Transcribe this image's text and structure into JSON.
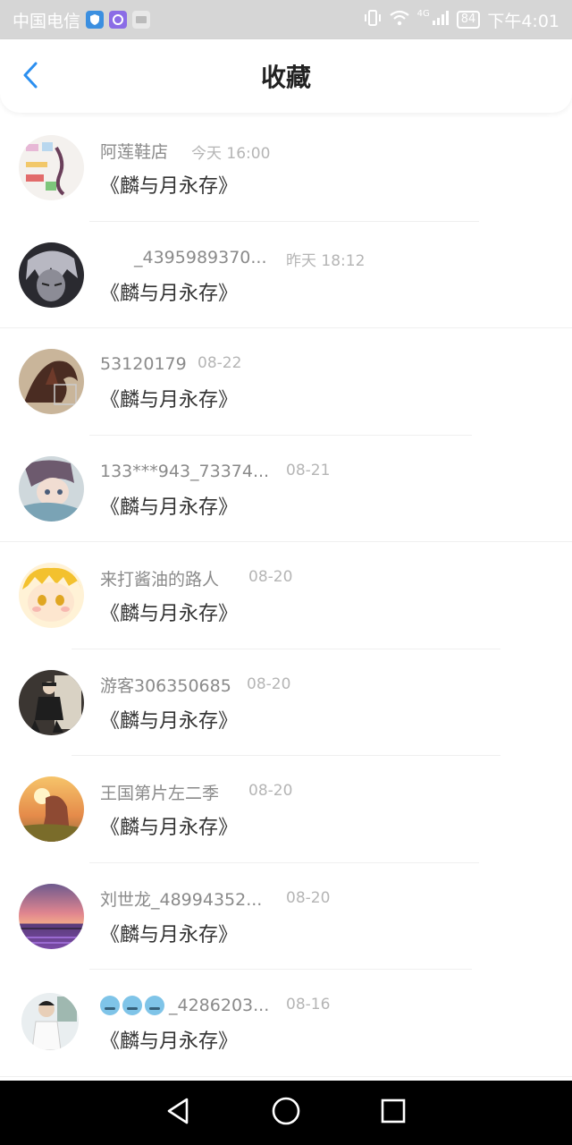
{
  "status_bar": {
    "carrier": "中国电信",
    "network": "4G",
    "battery": "84",
    "time": "下午4:01",
    "icons": [
      "shield-app-icon",
      "purple-app-icon",
      "message-app-icon",
      "vibrate-icon",
      "wifi-icon",
      "signal-icon",
      "battery-icon"
    ]
  },
  "header": {
    "back_icon": "chevron-left-icon",
    "title": "收藏"
  },
  "items": [
    {
      "username": "阿莲鞋店",
      "date": "今天 16:00",
      "content": "《麟与月永存》"
    },
    {
      "username": "_4395989370...",
      "date": "昨天 18:12",
      "content": "《麟与月永存》"
    },
    {
      "username": "53120179",
      "date": "08-22",
      "content": "《麟与月永存》"
    },
    {
      "username": "133***943_73374...",
      "date": "08-21",
      "content": "《麟与月永存》"
    },
    {
      "username": "来打酱油的路人",
      "date": "08-20",
      "content": "《麟与月永存》"
    },
    {
      "username": "游客306350685",
      "date": "08-20",
      "content": "《麟与月永存》"
    },
    {
      "username": "王国第片左二季",
      "date": "08-20",
      "content": "《麟与月永存》"
    },
    {
      "username": "刘世龙_48994352...",
      "date": "08-20",
      "content": "《麟与月永存》"
    },
    {
      "username": "_4286203...",
      "date": "08-16",
      "content": "《麟与月永存》"
    }
  ],
  "nav_bar": {
    "icons": [
      "back-triangle-icon",
      "home-circle-icon",
      "recents-square-icon"
    ]
  },
  "colors": {
    "accent": "#2b8ff0",
    "status_bar_bg": "#d6d6d6",
    "nav_bar_bg": "#000000"
  }
}
